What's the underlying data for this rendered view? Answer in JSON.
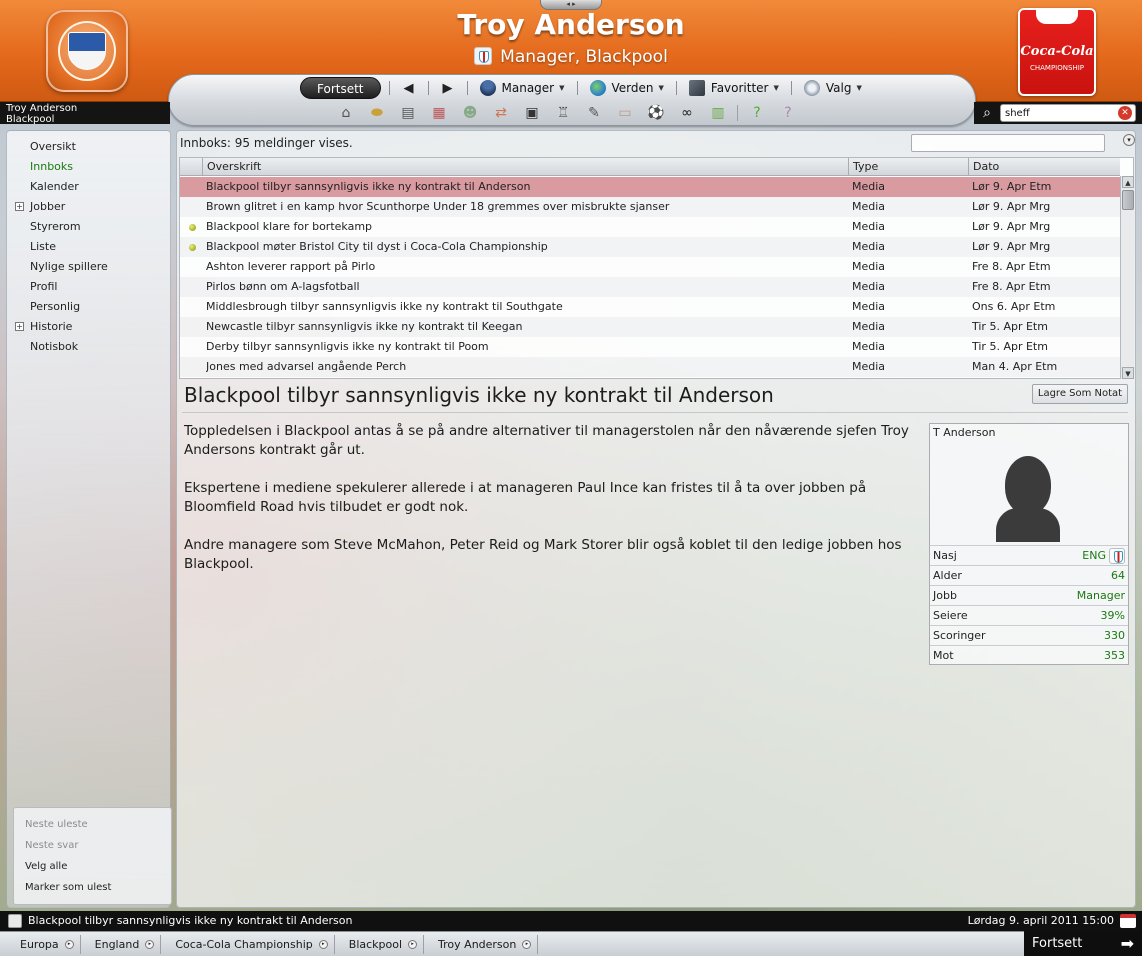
{
  "header": {
    "title": "Troy Anderson",
    "subtitle": "Manager, Blackpool",
    "club_crest_text": "BLACKPOOL FOOTBALL CLUB",
    "league_logo_text": "Coca-Cola",
    "league_logo_sub": "CHAMPIONSHIP",
    "brand_color": "#e4691c"
  },
  "whobar": {
    "name": "Troy Anderson",
    "club": "Blackpool"
  },
  "search": {
    "value": "sheff"
  },
  "nav": {
    "continue_label": "Fortsett",
    "back_icon": "arrow-left-icon",
    "forward_icon": "arrow-right-icon",
    "menus": [
      {
        "label": "Manager",
        "icon": "manager-icon"
      },
      {
        "label": "Verden",
        "icon": "globe-icon"
      },
      {
        "label": "Favoritter",
        "icon": "favorites-icon"
      },
      {
        "label": "Valg",
        "icon": "options-icon"
      }
    ],
    "toolbar_icons": [
      "home-icon",
      "club-icon",
      "news-icon",
      "calendar-icon",
      "squad-icon",
      "transfers-icon",
      "tactics-icon",
      "trophy-icon",
      "scout-icon",
      "notes-icon",
      "match-icon",
      "binoculars-icon",
      "finances-icon",
      "help-icon",
      "question-icon"
    ]
  },
  "sidebar": {
    "items": [
      {
        "label": "Oversikt",
        "expandable": false,
        "active": false
      },
      {
        "label": "Innboks",
        "expandable": false,
        "active": true
      },
      {
        "label": "Kalender",
        "expandable": false,
        "active": false
      },
      {
        "label": "Jobber",
        "expandable": true,
        "active": false
      },
      {
        "label": "Styrerom",
        "expandable": false,
        "active": false
      },
      {
        "label": "Liste",
        "expandable": false,
        "active": false
      },
      {
        "label": "Nylige spillere",
        "expandable": false,
        "active": false
      },
      {
        "label": "Profil",
        "expandable": false,
        "active": false
      },
      {
        "label": "Personlig",
        "expandable": false,
        "active": false
      },
      {
        "label": "Historie",
        "expandable": true,
        "active": false
      },
      {
        "label": "Notisbok",
        "expandable": false,
        "active": false
      }
    ],
    "actions": [
      {
        "label": "Neste uleste",
        "enabled": false
      },
      {
        "label": "Neste svar",
        "enabled": false
      },
      {
        "label": "Velg alle",
        "enabled": true
      },
      {
        "label": "Marker som ulest",
        "enabled": true
      }
    ]
  },
  "inbox": {
    "count_text": "Innboks: 95 meldinger vises.",
    "columns": [
      "Overskrift",
      "Type",
      "Dato"
    ],
    "messages": [
      {
        "subject": "Blackpool tilbyr sannsynligvis ikke ny kontrakt til Anderson",
        "type": "Media",
        "date": "Lør 9. Apr Etm",
        "selected": true,
        "flag": false
      },
      {
        "subject": "Brown glitret i en kamp hvor Scunthorpe Under 18 gremmes over misbrukte sjanser",
        "type": "Media",
        "date": "Lør 9. Apr Mrg",
        "selected": false,
        "flag": false
      },
      {
        "subject": "Blackpool klare for bortekamp",
        "type": "Media",
        "date": "Lør 9. Apr Mrg",
        "selected": false,
        "flag": true
      },
      {
        "subject": "Blackpool møter Bristol City til dyst i Coca-Cola Championship",
        "type": "Media",
        "date": "Lør 9. Apr Mrg",
        "selected": false,
        "flag": true
      },
      {
        "subject": "Ashton leverer rapport på Pirlo",
        "type": "Media",
        "date": "Fre 8. Apr Etm",
        "selected": false,
        "flag": false
      },
      {
        "subject": "Pirlos bønn om A-lagsfotball",
        "type": "Media",
        "date": "Fre 8. Apr Etm",
        "selected": false,
        "flag": false
      },
      {
        "subject": "Middlesbrough tilbyr sannsynligvis ikke ny kontrakt til Southgate",
        "type": "Media",
        "date": "Ons 6. Apr Etm",
        "selected": false,
        "flag": false
      },
      {
        "subject": "Newcastle tilbyr sannsynligvis ikke ny kontrakt til Keegan",
        "type": "Media",
        "date": "Tir 5. Apr Etm",
        "selected": false,
        "flag": false
      },
      {
        "subject": "Derby tilbyr sannsynligvis ikke ny kontrakt til Poom",
        "type": "Media",
        "date": "Tir 5. Apr Etm",
        "selected": false,
        "flag": false
      },
      {
        "subject": "Jones med advarsel angående Perch",
        "type": "Media",
        "date": "Man 4. Apr Etm",
        "selected": false,
        "flag": false
      }
    ]
  },
  "message": {
    "title": "Blackpool tilbyr sannsynligvis ikke ny kontrakt til Anderson",
    "save_note_label": "Lagre Som Notat",
    "paragraphs": [
      "Toppledelsen i Blackpool antas å se på andre alternativer til managerstolen når den nåværende sjefen Troy Andersons kontrakt går ut.",
      "Ekspertene i mediene spekulerer allerede i at manageren Paul Ince kan fristes til å ta over jobben på Bloomfield Road hvis tilbudet er godt nok.",
      "Andre managere som Steve McMahon, Peter Reid og Mark Storer blir også koblet til den ledige jobben hos Blackpool."
    ]
  },
  "profile": {
    "name": "T Anderson",
    "rows": [
      {
        "label": "Nasj",
        "value": "ENG"
      },
      {
        "label": "Alder",
        "value": "64"
      },
      {
        "label": "Jobb",
        "value": "Manager"
      },
      {
        "label": "Seiere",
        "value": "39%"
      },
      {
        "label": "Scoringer",
        "value": "330"
      },
      {
        "label": "Mot",
        "value": "353"
      }
    ]
  },
  "status": {
    "text": "Blackpool tilbyr sannsynligvis ikke ny kontrakt til Anderson",
    "datetime": "Lørdag 9. april 2011 15:00"
  },
  "breadcrumbs": [
    "Europa",
    "England",
    "Coca-Cola Championship",
    "Blackpool",
    "Troy Anderson"
  ],
  "continue_button": {
    "label": "Fortsett"
  }
}
